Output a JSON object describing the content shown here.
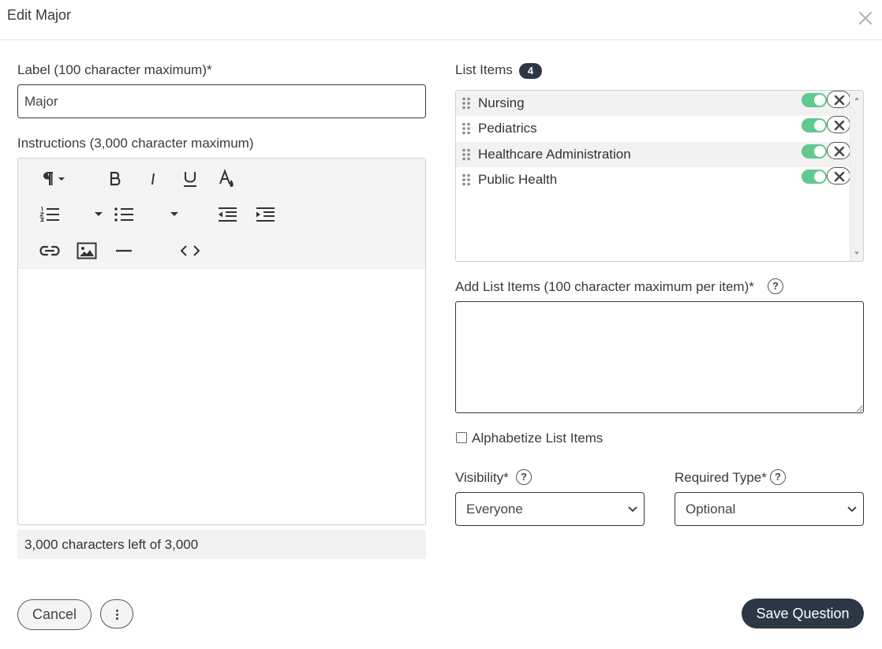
{
  "modal": {
    "title": "Edit Major",
    "close_icon": "close-icon"
  },
  "label_field": {
    "label": "Label (100 character maximum)*",
    "value": "Major"
  },
  "instructions": {
    "label": "Instructions (3,000 character maximum)",
    "toolbar_icons": [
      "paragraph-icon",
      "bold-icon",
      "italic-icon",
      "underline-icon",
      "text-color-icon",
      "ordered-list-icon",
      "unordered-list-icon",
      "outdent-icon",
      "indent-icon",
      "link-icon",
      "image-icon",
      "horizontal-rule-icon",
      "code-view-icon"
    ],
    "counter": "3,000 characters left of 3,000"
  },
  "list_items": {
    "label": "List Items",
    "count": "4",
    "items": [
      {
        "label": "Nursing",
        "enabled": true
      },
      {
        "label": "Pediatrics",
        "enabled": true
      },
      {
        "label": "Healthcare Administration",
        "enabled": true
      },
      {
        "label": "Public Health",
        "enabled": true
      }
    ],
    "toggle_color": "#5fc98e"
  },
  "add_items": {
    "label": "Add List Items (100 character maximum per item)*",
    "value": ""
  },
  "alphabetize": {
    "label": "Alphabetize List Items",
    "checked": false
  },
  "visibility": {
    "label": "Visibility*",
    "value": "Everyone"
  },
  "required_type": {
    "label": "Required Type*",
    "value": "Optional"
  },
  "footer": {
    "cancel_label": "Cancel",
    "more_icon": "more-vertical-icon",
    "save_label": "Save Question",
    "save_color": "#2c3745"
  }
}
